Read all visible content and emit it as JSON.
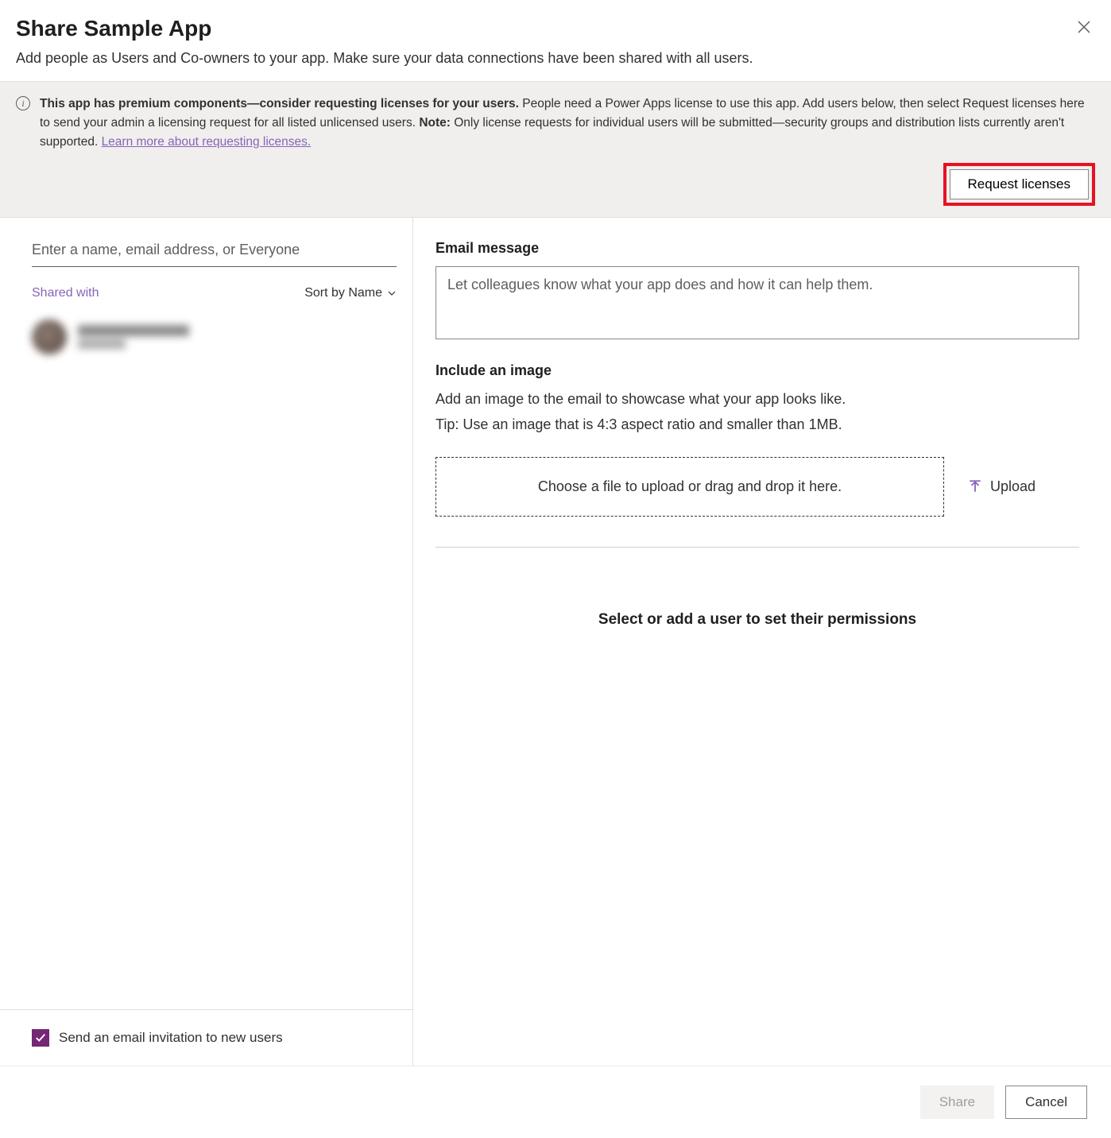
{
  "header": {
    "title": "Share Sample App"
  },
  "subtitle": "Add people as Users and Co-owners to your app. Make sure your data connections have been shared with all users.",
  "banner": {
    "bold1": "This app has premium components—consider requesting licenses for your users.",
    "text1": " People need a Power Apps license to use this app. Add users below, then select Request licenses here to send your admin a licensing request for all listed unlicensed users. ",
    "bold2": "Note:",
    "text2": " Only license requests for individual users will be submitted—security groups and distribution lists currently aren't supported. ",
    "link": "Learn more about requesting licenses.",
    "request_button": "Request licenses"
  },
  "left": {
    "search_placeholder": "Enter a name, email address, or Everyone",
    "shared_with": "Shared with",
    "sort_by": "Sort by Name",
    "email_checkbox_label": "Send an email invitation to new users"
  },
  "right": {
    "email_label": "Email message",
    "email_placeholder": "Let colleagues know what your app does and how it can help them.",
    "image_label": "Include an image",
    "image_desc1": "Add an image to the email to showcase what your app looks like.",
    "image_desc2": "Tip: Use an image that is 4:3 aspect ratio and smaller than 1MB.",
    "dropzone": "Choose a file to upload or drag and drop it here.",
    "upload": "Upload",
    "permissions_prompt": "Select or add a user to set their permissions"
  },
  "footer": {
    "share": "Share",
    "cancel": "Cancel"
  }
}
